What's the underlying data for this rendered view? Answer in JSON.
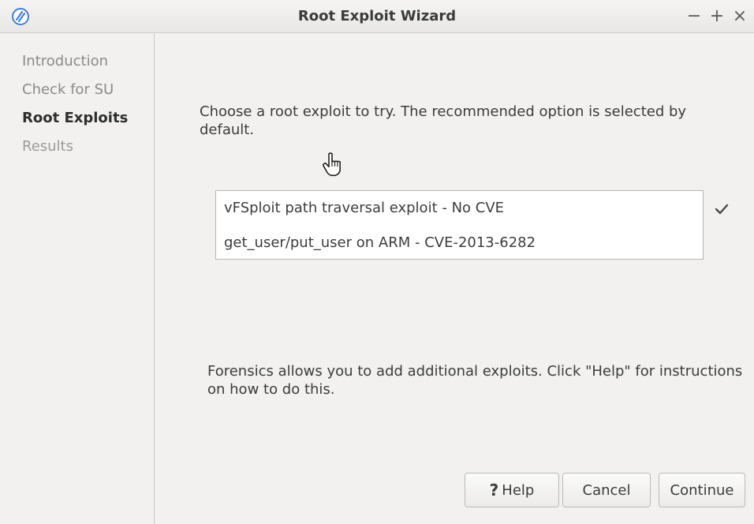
{
  "window": {
    "title": "Root Exploit Wizard",
    "controls": {
      "minimize": "−",
      "maximize": "+",
      "close": "×"
    }
  },
  "sidebar": {
    "steps": [
      {
        "label": "Introduction",
        "state": "done"
      },
      {
        "label": "Check for SU",
        "state": "done"
      },
      {
        "label": "Root Exploits",
        "state": "current"
      },
      {
        "label": "Results",
        "state": "pending"
      }
    ]
  },
  "main": {
    "prompt": "Choose a root exploit to try. The recommended option is selected by default.",
    "exploits": [
      {
        "label": "vFSploit path traversal exploit - No CVE",
        "selected": true
      },
      {
        "label": "get_user/put_user on ARM - CVE-2013-6282",
        "selected": false
      }
    ],
    "note": "Forensics allows you to add additional exploits. Click \"Help\" for instructions on how to do this."
  },
  "buttons": {
    "help_icon": "?",
    "help_label": "Help",
    "cancel_label": "Cancel",
    "continue_label": "Continue"
  },
  "icons": {
    "app": "app-logo-icon",
    "cursor": "hand-pointer-icon",
    "check": "checkmark-icon"
  },
  "colors": {
    "app_icon": "#3f7fd6",
    "window_bg": "#f2f1f0",
    "list_bg": "#ffffff"
  }
}
